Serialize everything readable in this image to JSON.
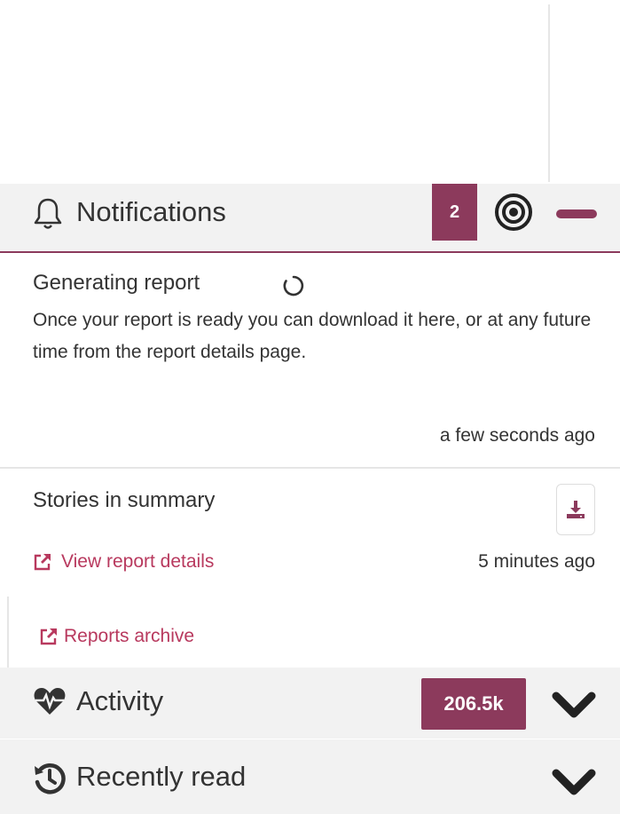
{
  "notifications": {
    "title": "Notifications",
    "count": "2",
    "icons": [
      "bell-icon",
      "target-icon",
      "minus-icon"
    ],
    "items": [
      {
        "title": "Generating report",
        "body": "Once your report is ready you can download it here, or at any future time from the report details page.",
        "time": "a few seconds ago",
        "icon": "spinner-icon"
      },
      {
        "title": "Stories in summary",
        "link": "View report details",
        "time": "5 minutes ago",
        "icon": "download-icon"
      }
    ],
    "archive_link": "Reports archive"
  },
  "activity": {
    "title": "Activity",
    "count": "206.5k",
    "icon": "heartbeat-icon"
  },
  "recently_read": {
    "title": "Recently read",
    "icon": "history-icon"
  },
  "colors": {
    "accent": "#8c3a5c",
    "link": "#b8395e",
    "panel_bg": "#f2f2f2"
  }
}
